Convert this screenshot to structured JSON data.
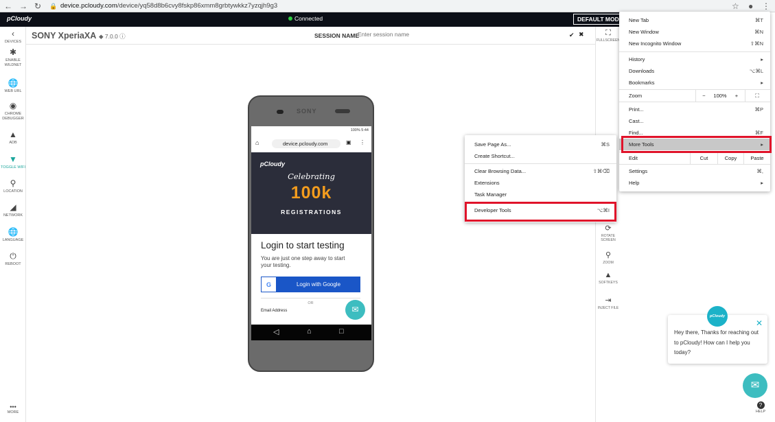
{
  "browser": {
    "url_host": "device.pcloudy.com",
    "url_path": "/device/yq58d8b6cvy8fskp86xmm8grbtywkkz7yzqjh9g3"
  },
  "app": {
    "logo": "pCloudy",
    "status": "Connected",
    "mode": "DEFAULT MODE"
  },
  "header": {
    "device_name": "SONY XperiaXA",
    "device_version": "◆ 7.0.0 ⓘ",
    "session_label": "SESSION NAME",
    "session_placeholder": "Enter session name",
    "tick": "✔",
    "close": "✖"
  },
  "sidebar": {
    "items": [
      "DEVICES",
      "ENABLE WILDNET",
      "WEB URL",
      "CHROME DEBUGGER",
      "ADB",
      "TOGGLE WIFI",
      "LOCATION",
      "NETWORK",
      "LANGUAGE",
      "REBOOT"
    ],
    "more": "MORE"
  },
  "righttools": {
    "fullscreen": "FULLSCREEN",
    "rotate": "ROTATE SCREEN",
    "zoom": "ZOOM",
    "softkeys": "SOFTKEYS",
    "inject": "INJECT FILE"
  },
  "phone": {
    "brand": "SONY",
    "status": "100% 5:44",
    "url": "device.pcloudy.com",
    "banner_logo": "pCloudy",
    "celebrating": "Celebrating",
    "count": "100k",
    "registrations": "REGISTRATIONS",
    "login_title": "Login to start testing",
    "login_sub": "You are just one step away to start your testing.",
    "google_button": "Login with Google",
    "or": "OR",
    "email_label": "Email Address"
  },
  "chrome_menu": {
    "new_tab": "New Tab",
    "new_tab_sc": "⌘T",
    "new_window": "New Window",
    "new_window_sc": "⌘N",
    "incognito": "New Incognito Window",
    "incognito_sc": "⇧⌘N",
    "history": "History",
    "downloads": "Downloads",
    "downloads_sc": "⌥⌘L",
    "bookmarks": "Bookmarks",
    "zoom": "Zoom",
    "zoom_minus": "−",
    "zoom_value": "100%",
    "zoom_plus": "+",
    "print": "Print...",
    "print_sc": "⌘P",
    "cast": "Cast...",
    "find": "Find...",
    "find_sc": "⌘F",
    "more_tools": "More Tools",
    "edit": "Edit",
    "cut": "Cut",
    "copy": "Copy",
    "paste": "Paste",
    "settings": "Settings",
    "settings_sc": "⌘,",
    "help": "Help",
    "arrow": "▸"
  },
  "submenu": {
    "save_page": "Save Page As...",
    "save_page_sc": "⌘S",
    "create_shortcut": "Create Shortcut...",
    "clear_data": "Clear Browsing Data...",
    "clear_data_sc": "⇧⌘⌫",
    "extensions": "Extensions",
    "task_manager": "Task Manager",
    "dev_tools": "Developer Tools",
    "dev_tools_sc": "⌥⌘I"
  },
  "chat": {
    "avatar": "pCloudy",
    "message": "Hey there, Thanks for reaching out to pCloudy! How can I help you today?",
    "help": "HELP"
  },
  "colors": {
    "accent": "#1aa59b",
    "highlight_box": "#e0132a",
    "topbar": "#0c0f17",
    "google_blue": "#1a56c7"
  }
}
